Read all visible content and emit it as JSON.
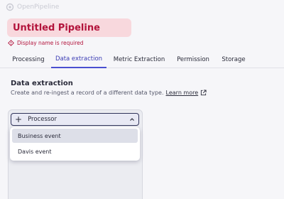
{
  "app": {
    "name": "OpenPipeline"
  },
  "pipeline": {
    "title": "Untitled Pipeline",
    "error": "Display name is required"
  },
  "tabs": [
    {
      "label": "Processing",
      "active": false
    },
    {
      "label": "Data extraction",
      "active": true
    },
    {
      "label": "Metric Extraction",
      "active": false
    },
    {
      "label": "Permission",
      "active": false
    },
    {
      "label": "Storage",
      "active": false
    }
  ],
  "section": {
    "title": "Data extraction",
    "description": "Create and re-ingest a record of a different data type.",
    "link": "Learn more"
  },
  "processor": {
    "label": "Processor",
    "options": [
      {
        "label": "Business event",
        "highlighted": true
      },
      {
        "label": "Davis event",
        "highlighted": false
      }
    ]
  },
  "colors": {
    "error": "#b3143c",
    "error_bg": "#f8d8dd",
    "accent": "#4a4fd1"
  }
}
